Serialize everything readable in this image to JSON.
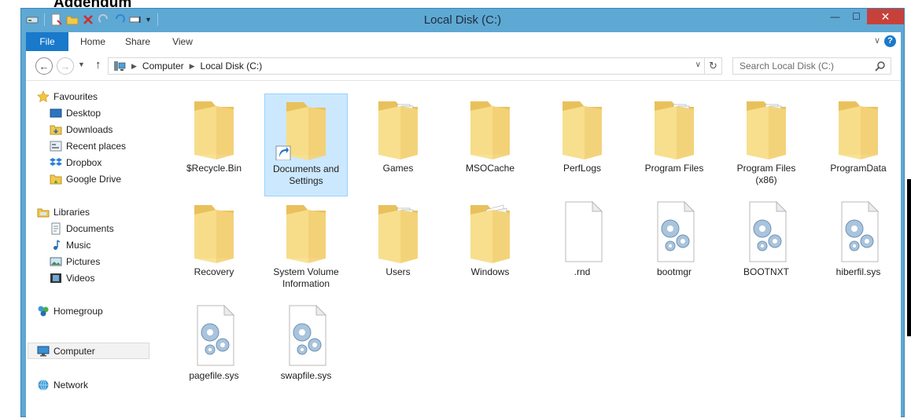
{
  "background": {
    "heading": "Addendum"
  },
  "window": {
    "title": "Local Disk (C:)",
    "minimize_label": "—",
    "maximize_label": "☐",
    "close_label": "✕"
  },
  "ribbon": {
    "tabs": [
      "File",
      "Home",
      "Share",
      "View"
    ],
    "help_label": "?"
  },
  "address": {
    "back_label": "←",
    "forward_label": "→",
    "up_label": "↑",
    "crumbs": [
      "Computer",
      "Local Disk (C:)"
    ],
    "search_placeholder": "Search Local Disk (C:)"
  },
  "nav": {
    "favourites": "Favourites",
    "favourites_items": [
      "Desktop",
      "Downloads",
      "Recent places",
      "Dropbox",
      "Google Drive"
    ],
    "libraries": "Libraries",
    "libraries_items": [
      "Documents",
      "Music",
      "Pictures",
      "Videos"
    ],
    "homegroup": "Homegroup",
    "computer": "Computer",
    "network": "Network"
  },
  "files": [
    {
      "name": "$Recycle.Bin",
      "name2": "",
      "kind": "folder-empty"
    },
    {
      "name": "Documents and",
      "name2": "Settings",
      "kind": "folder-shortcut"
    },
    {
      "name": "Games",
      "name2": "",
      "kind": "folder-docs"
    },
    {
      "name": "MSOCache",
      "name2": "",
      "kind": "folder-empty"
    },
    {
      "name": "PerfLogs",
      "name2": "",
      "kind": "folder-plain"
    },
    {
      "name": "Program Files",
      "name2": "",
      "kind": "folder-docs"
    },
    {
      "name": "Program Files",
      "name2": "(x86)",
      "kind": "folder-docs"
    },
    {
      "name": "ProgramData",
      "name2": "",
      "kind": "folder-empty"
    },
    {
      "name": "Recovery",
      "name2": "",
      "kind": "folder-empty"
    },
    {
      "name": "System Volume",
      "name2": "Information",
      "kind": "folder-empty"
    },
    {
      "name": "Users",
      "name2": "",
      "kind": "folder-docs"
    },
    {
      "name": "Windows",
      "name2": "",
      "kind": "folder-pages"
    },
    {
      "name": ".rnd",
      "name2": "",
      "kind": "file-blank"
    },
    {
      "name": "bootmgr",
      "name2": "",
      "kind": "file-system"
    },
    {
      "name": "BOOTNXT",
      "name2": "",
      "kind": "file-system"
    },
    {
      "name": "hiberfil.sys",
      "name2": "",
      "kind": "file-system"
    },
    {
      "name": "pagefile.sys",
      "name2": "",
      "kind": "file-system"
    },
    {
      "name": "swapfile.sys",
      "name2": "",
      "kind": "file-system"
    }
  ],
  "colors": {
    "window_frame": "#5ea8d4",
    "file_tab": "#1979ca",
    "close_button": "#c7413a",
    "selection": "#cce8ff",
    "folder": "#f2d37a"
  }
}
